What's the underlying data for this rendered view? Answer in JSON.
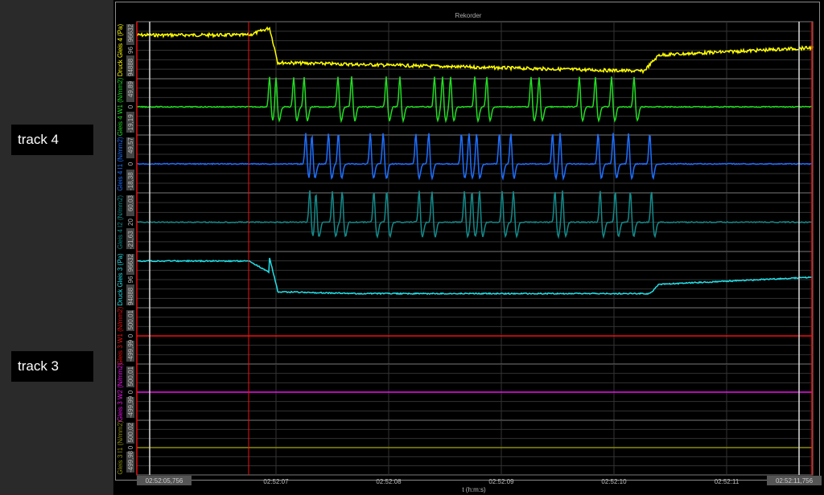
{
  "tracks": [
    "track 4",
    "track 3"
  ],
  "recorder": {
    "title": "Rekorder",
    "x_axis_label": "t (h:m:s)",
    "x_ticks": [
      "02:52:07",
      "02:52:08",
      "02:52:09",
      "02:52:10",
      "02:52:11"
    ],
    "x_start": "02:52:05,756",
    "x_end": "02:52:11,756"
  },
  "channels": [
    {
      "label": "Druck Gleis 4 (Pa)",
      "color": "#ffff00",
      "max": "96632",
      "mid": "96",
      "min": "94888",
      "kind": "pressure4"
    },
    {
      "label": "Gleis 4 W1 (N/mm2)",
      "color": "#22dd22",
      "max": "49,89",
      "mid": "0",
      "min": "-19,19",
      "kind": "w1"
    },
    {
      "label": "Gleis 4 I1 (N/mm2)",
      "color": "#1e6fff",
      "max": "49,57",
      "mid": "0",
      "min": "-18,38",
      "kind": "i1"
    },
    {
      "label": "Gleis 4 I2 (N/mm2)",
      "color": "#138a8a",
      "max": "60,03",
      "mid": "20",
      "min": "-21,63",
      "kind": "i2"
    },
    {
      "label": "Druck Gleis 3 (Pa)",
      "color": "#22e0e8",
      "max": "96632",
      "mid": "96",
      "min": "94888",
      "kind": "pressure3"
    },
    {
      "label": "Gleis 3 W1 (N/mm2)",
      "color": "#ee1111",
      "max": "500,01",
      "mid": "0",
      "min": "-499,99",
      "kind": "flat"
    },
    {
      "label": "Gleis 3 W2 (N/mm2)",
      "color": "#ee11ee",
      "max": "500,01",
      "mid": "0",
      "min": "-499,99",
      "kind": "flat"
    },
    {
      "label": "Gleis 3 I1 (N/mm2)",
      "color": "#8c8c10",
      "max": "500,02",
      "mid": "0",
      "min": "-499,98",
      "kind": "flat"
    }
  ]
}
